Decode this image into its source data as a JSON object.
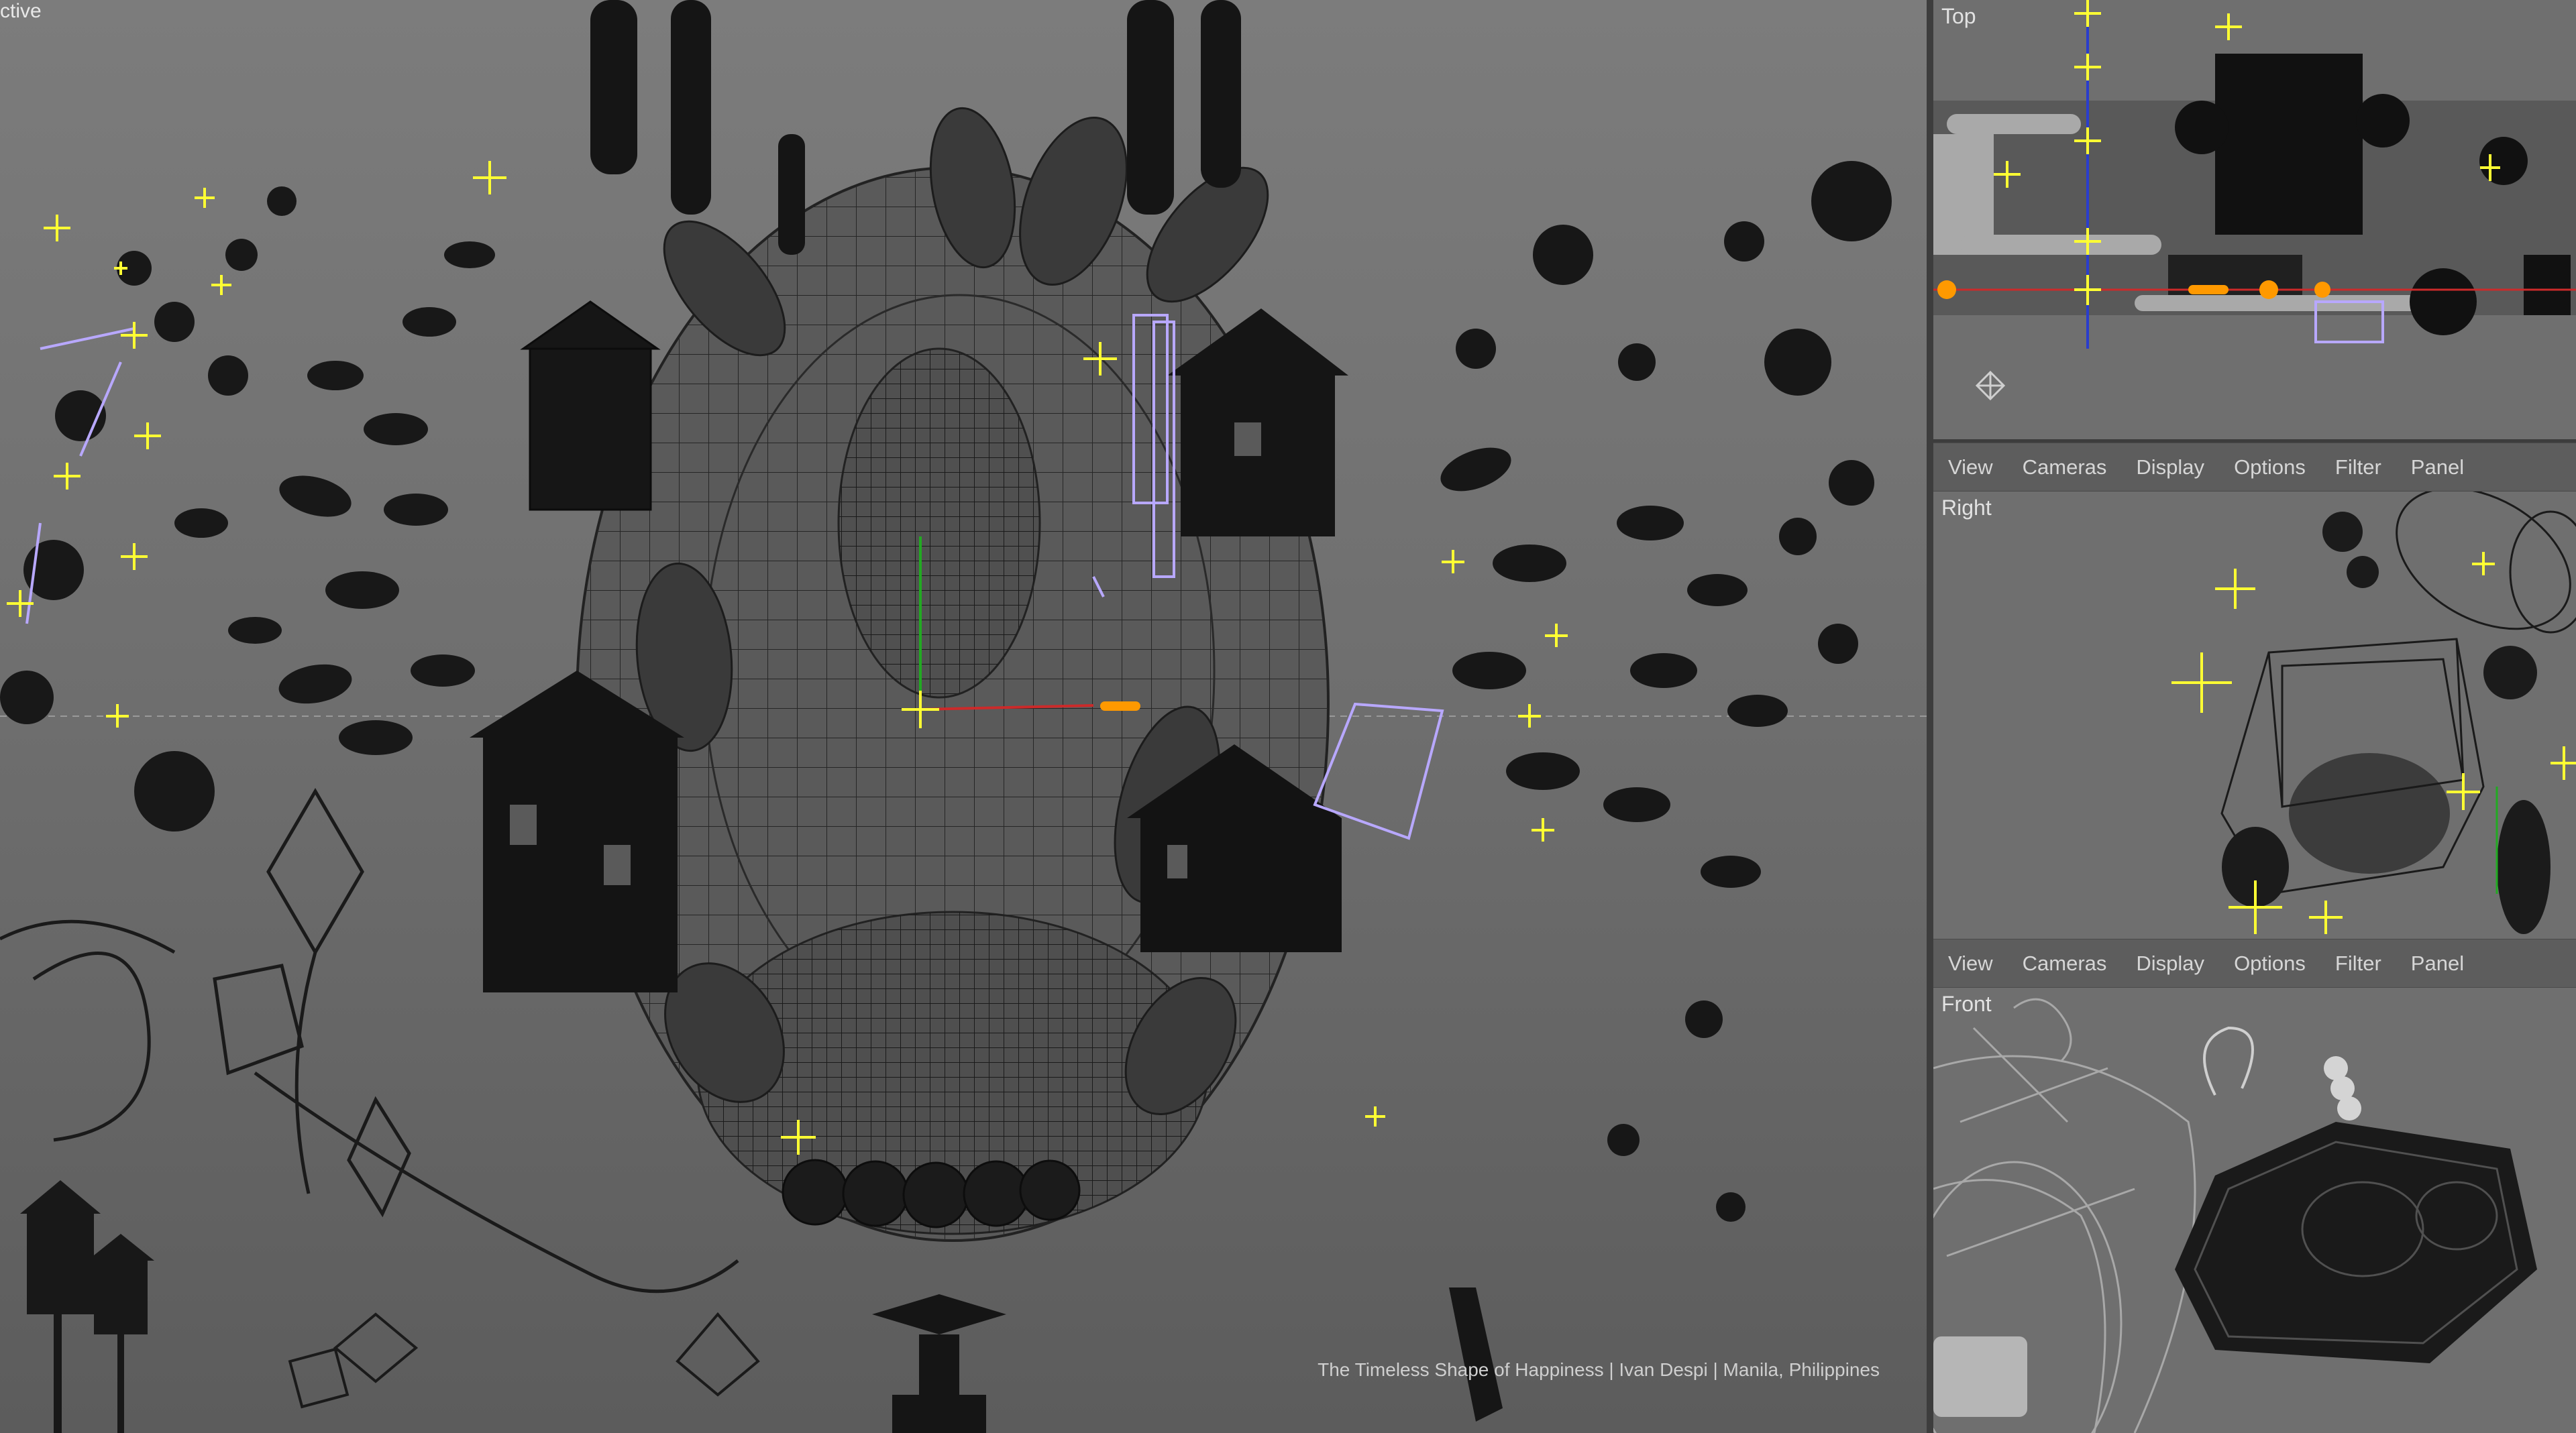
{
  "perspective": {
    "label": "ctive",
    "credit": "The Timeless Shape of Happiness | Ivan Despi | Manila, Philippines"
  },
  "panels": {
    "top": {
      "label": "Top"
    },
    "right": {
      "label": "Right"
    },
    "front": {
      "label": "Front"
    }
  },
  "panel_menu": {
    "items": [
      "View",
      "Cameras",
      "Display",
      "Options",
      "Filter",
      "Panel"
    ]
  },
  "colors": {
    "viewport_bg": "#737373",
    "mesh": "#1f1f1f",
    "wire": "#2a2a2a",
    "locator": "#ffff33",
    "selection": "#b8a8ff",
    "axis_x": "#cc2a2a",
    "axis_y": "#22aa22",
    "axis_z": "#2a3dcc",
    "highlight_orange": "#ff9900"
  },
  "icons": {
    "manipulator": "move-manipulator-icon",
    "locator": "locator-cross-icon"
  }
}
